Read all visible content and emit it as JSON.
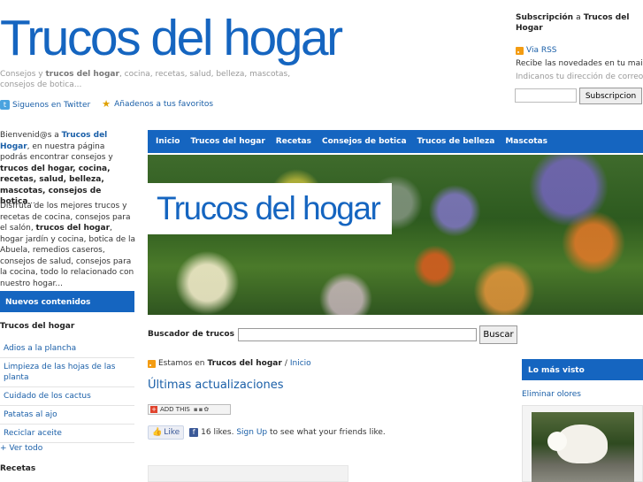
{
  "header": {
    "site_title": "Trucos del hogar",
    "tagline_pre": "Consejos y ",
    "tagline_bold": "trucos del hogar",
    "tagline_post": ", cocina, recetas, salud, belleza, mascotas, consejos de botica...",
    "twitter_link": "Siguenos en Twitter",
    "favorites_link": "Añadenos a tus favoritos"
  },
  "subscription": {
    "title_1": "Subscripción",
    "title_a": "a",
    "title_2": "Trucos del Hogar",
    "rss_label": "Via RSS",
    "description": "Recibe las novedades en tu mail.",
    "hint": "Indicanos tu dirección de correo.",
    "email_value": "",
    "button_label": "Subscripcion"
  },
  "intro": {
    "p1_pre": "Bienvenid@s a ",
    "p1_link": "Trucos del Hogar",
    "p1_mid": ", en nuestra página podrás encontrar consejos y ",
    "p1_bold": "trucos del hogar, cocina, recetas, salud, belleza, mascotas, consejos de botica",
    "p1_end": "...",
    "p2_pre": "Disfruta de los mejores trucos y recetas de cocina, consejos para el salón, ",
    "p2_bold": "trucos del hogar",
    "p2_post": ", hogar jardín y cocina, botica de la Abuela, remedios caseros, consejos de salud, consejos para la cocina, todo lo relacionado con nuestro hogar..."
  },
  "sidebar": {
    "new_content_label": "Nuevos contenidos",
    "trucos_heading": "Trucos del hogar",
    "trucos_items": [
      {
        "label": "Adios a la plancha"
      },
      {
        "label": "Limpieza de las hojas de las planta"
      },
      {
        "label": "Cuidado de los cactus"
      },
      {
        "label": "Patatas al ajo"
      },
      {
        "label": "Reciclar aceite"
      }
    ],
    "ver_todo": "+ Ver todo",
    "recetas_heading": "Recetas"
  },
  "main_nav": {
    "items": [
      {
        "label": "Inicio"
      },
      {
        "label": "Trucos del hogar"
      },
      {
        "label": "Recetas"
      },
      {
        "label": "Consejos de botica"
      },
      {
        "label": "Trucos de belleza"
      },
      {
        "label": "Mascotas"
      }
    ]
  },
  "banner": {
    "title": "Trucos del hogar"
  },
  "search": {
    "label": "Buscador de trucos",
    "value": "",
    "button_label": "Buscar"
  },
  "breadcrumb": {
    "prefix": "Estamos en",
    "section": "Trucos del hogar",
    "separator": "/",
    "current": "Inicio"
  },
  "content": {
    "heading": "Últimas actualizaciones",
    "addthis_label": "ADD THIS",
    "like_button": "Like",
    "likes_text": "16 likes.",
    "signup_link": "Sign Up",
    "signup_post": "to see what your friends like."
  },
  "most_viewed": {
    "title": "Lo más visto",
    "item_label": "Eliminar olores"
  },
  "colors": {
    "accent": "#1565c0",
    "link": "#1a5fa8"
  }
}
